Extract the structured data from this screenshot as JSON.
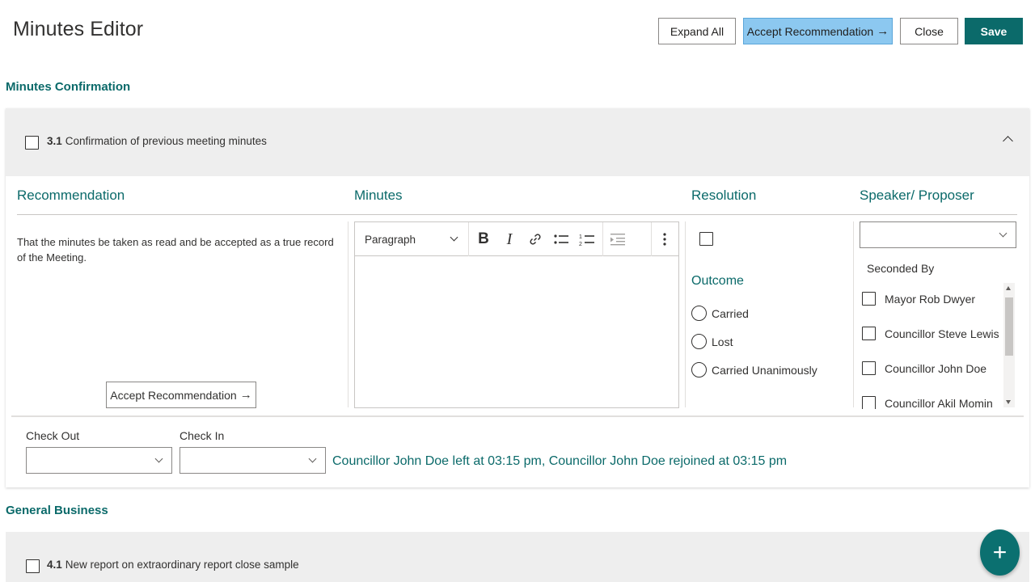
{
  "header": {
    "title": "Minutes Editor",
    "expand_all": "Expand All",
    "accept_recommendation": "Accept Recommendation",
    "close": "Close",
    "save": "Save"
  },
  "sections": {
    "minutes_confirmation": "Minutes Confirmation",
    "general_business": "General Business"
  },
  "item1": {
    "number": "3.1",
    "title": "Confirmation of previous meeting minutes",
    "columns": {
      "recommendation": "Recommendation",
      "minutes": "Minutes",
      "resolution": "Resolution",
      "speaker": "Speaker/ Proposer"
    },
    "recommendation_text": "That the minutes be taken as read and be accepted as a true record of the Meeting.",
    "accept_button": "Accept Recommendation",
    "editor": {
      "paragraph": "Paragraph",
      "bold": "B",
      "italic": "I"
    },
    "outcome_label": "Outcome",
    "outcomes": [
      "Carried",
      "Lost",
      "Carried Unanimously"
    ],
    "seconded_by": "Seconded By",
    "seconders": [
      "Mayor Rob Dwyer",
      "Councillor Steve Lewis",
      "Councillor John Doe",
      "Councillor Akil Momin"
    ],
    "check_out_label": "Check Out",
    "check_in_label": "Check In",
    "status": "Councillor John Doe left at 03:15 pm,  Councillor John Doe rejoined at 03:15 pm"
  },
  "item2": {
    "number": "4.1",
    "title": "New report on extraordinary report close sample"
  },
  "fab": "+",
  "colors": {
    "accent": "#0b6a6a",
    "accept_button_bg": "#8cc8f0",
    "card_header_bg": "#eeeeee"
  }
}
